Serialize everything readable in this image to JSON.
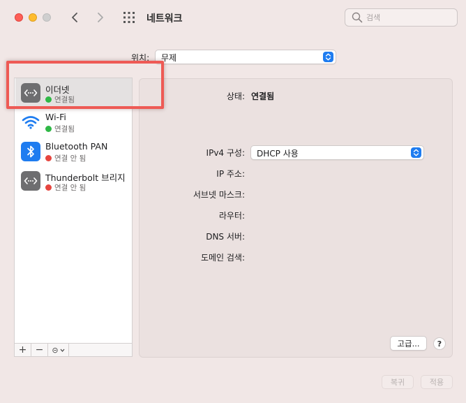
{
  "window": {
    "title": "네트워크",
    "search": {
      "placeholder": "검색",
      "value": ""
    },
    "icons": [
      "back-chevron-icon",
      "forward-chevron-icon",
      "grid-icon",
      "search-icon"
    ]
  },
  "location": {
    "label": "위치:",
    "value": "무제"
  },
  "services": [
    {
      "name": "이더넷",
      "status": "연결됨",
      "status_color": "#2fb846",
      "icon": "ethernet-icon",
      "selected": true
    },
    {
      "name": "Wi-Fi",
      "status": "연결됨",
      "status_color": "#2fb846",
      "icon": "wifi-icon",
      "selected": false
    },
    {
      "name": "Bluetooth PAN",
      "status": "연결 안 됨",
      "status_color": "#e6453f",
      "icon": "bluetooth-icon",
      "selected": false
    },
    {
      "name": "Thunderbolt 브리지",
      "status": "연결 안 됨",
      "status_color": "#e6453f",
      "icon": "thunderbolt-bridge-icon",
      "selected": false
    }
  ],
  "sidebar_toolbar": {
    "add": "+",
    "remove": "−",
    "action": "⊝"
  },
  "detail": {
    "status_label": "상태:",
    "status_value": "연결됨",
    "ipv4_label": "IPv4 구성:",
    "ipv4_value": "DHCP 사용",
    "ip_label": "IP 주소:",
    "subnet_label": "서브넷 마스크:",
    "router_label": "라우터:",
    "dns_label": "DNS 서버:",
    "domain_label": "도메인 검색:",
    "advanced_label": "고급...",
    "help_label": "?"
  },
  "footer": {
    "revert_label": "복귀",
    "apply_label": "적용"
  },
  "colors": {
    "accent": "#1e7cf0",
    "highlight": "#ee5a55",
    "connected": "#2fb846",
    "disconnected": "#e6453f"
  }
}
